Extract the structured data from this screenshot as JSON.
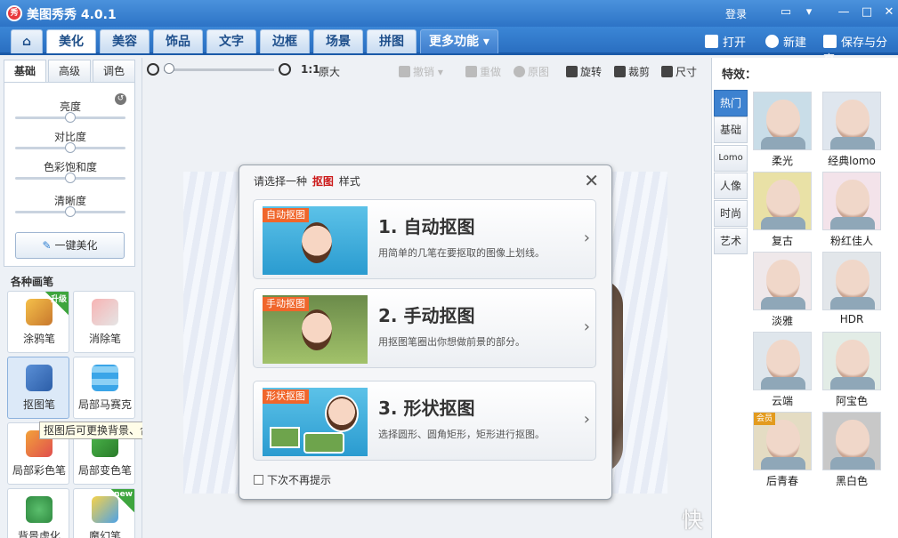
{
  "titlebar": {
    "app_title": "美图秀秀 4.0.1",
    "logo_text": "秀",
    "login": "登录"
  },
  "main_tabs": [
    {
      "label": "",
      "icon": "home-icon"
    },
    {
      "label": "美化"
    },
    {
      "label": "美容"
    },
    {
      "label": "饰品"
    },
    {
      "label": "文字"
    },
    {
      "label": "边框"
    },
    {
      "label": "场景"
    },
    {
      "label": "拼图"
    },
    {
      "label": "更多功能 ▾"
    }
  ],
  "toolbar": {
    "open": "打开",
    "new": "新建",
    "save_share": "保存与分享"
  },
  "subtabs": [
    "基础",
    "高级",
    "调色"
  ],
  "sliders": [
    {
      "label": "亮度",
      "value": 0.5
    },
    {
      "label": "对比度",
      "value": 0.5
    },
    {
      "label": "色彩饱和度",
      "value": 0.5
    },
    {
      "label": "清晰度",
      "value": 0.5
    }
  ],
  "onekey_label": "一键美化",
  "brushes": {
    "title": "各种画笔",
    "items": [
      {
        "label": "涂鸦笔",
        "badge": "升级",
        "badge_color": "#3ea53e"
      },
      {
        "label": "消除笔"
      },
      {
        "label": "抠图笔"
      },
      {
        "label": "局部马赛克"
      },
      {
        "label": "局部彩色笔"
      },
      {
        "label": "局部变色笔"
      },
      {
        "label": "背景虚化"
      },
      {
        "label": "魔幻笔",
        "badge": "new",
        "badge_color": "#3ea53e"
      }
    ]
  },
  "tooltip": "抠图后可更换背景、合成图片",
  "zoom": {
    "ratio": "1:1",
    "ratio_label": "原大",
    "level": 0
  },
  "edit_actions": {
    "undo": "撤销",
    "redo": "重做",
    "original": "原图",
    "rotate": "旋转",
    "crop": "裁剪",
    "resize": "尺寸"
  },
  "dialog": {
    "title_prefix": "请选择一种",
    "title_highlight": "抠图",
    "title_suffix": "样式",
    "options": [
      {
        "tag": "自动抠图",
        "heading": "1. 自动抠图",
        "desc": "用简单的几笔在要抠取的图像上划线。"
      },
      {
        "tag": "手动抠图",
        "heading": "2. 手动抠图",
        "desc": "用抠图笔圈出你想做前景的部分。"
      },
      {
        "tag": "形状抠图",
        "heading": "3. 形状抠图",
        "desc": "选择圆形、圆角矩形，矩形进行抠图。"
      }
    ],
    "noshow": "下次不再提示"
  },
  "effects": {
    "title": "特效：",
    "categories": [
      "热门",
      "基础",
      "Lomo",
      "人像",
      "时尚",
      "艺术"
    ],
    "active_category": 0,
    "items": [
      {
        "label": "柔光",
        "tint": "#c9dde8"
      },
      {
        "label": "经典lomo",
        "tint": "#dfe6ee"
      },
      {
        "label": "复古",
        "tint": "#e9e1a6"
      },
      {
        "label": "粉红佳人",
        "tint": "#f3e3ea"
      },
      {
        "label": "淡雅",
        "tint": "#efe8ea"
      },
      {
        "label": "HDR",
        "tint": "#e2e6ea"
      },
      {
        "label": "云端",
        "tint": "#dfe6ec"
      },
      {
        "label": "阿宝色",
        "tint": "#e2ece6"
      },
      {
        "label": "后青春",
        "tint": "#e4dcc3",
        "badge": "会员"
      },
      {
        "label": "黑白色",
        "tint": "#c8c8c8"
      }
    ]
  },
  "watermark": "快"
}
